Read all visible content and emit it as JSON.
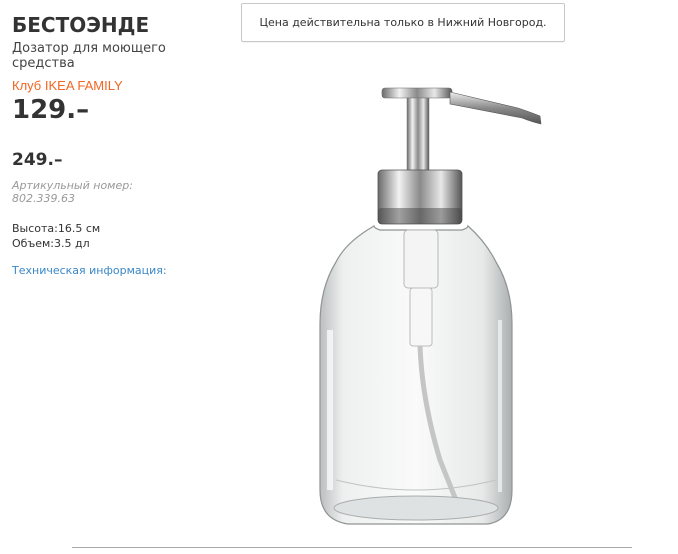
{
  "product": {
    "name": "БЕСТОЭНДЕ",
    "description": "Дозатор для моющего средства",
    "family_label": "Клуб IKEA FAMILY",
    "family_price": "129.–",
    "price": "249.–",
    "article_label": "Артикульный номер:",
    "article_number": "802.339.63",
    "height_label": "Высота:",
    "height_value": "16.5 см",
    "volume_label": "Объем:",
    "volume_value": "3.5 дл",
    "tech_link": "Техническая информация:"
  },
  "notice": {
    "text": "Цена действительна только в Нижний Новгород."
  },
  "image": {
    "alt": "soap-dispenser-image"
  },
  "colors": {
    "family_accent": "#f26522",
    "link": "#3a87c8"
  }
}
